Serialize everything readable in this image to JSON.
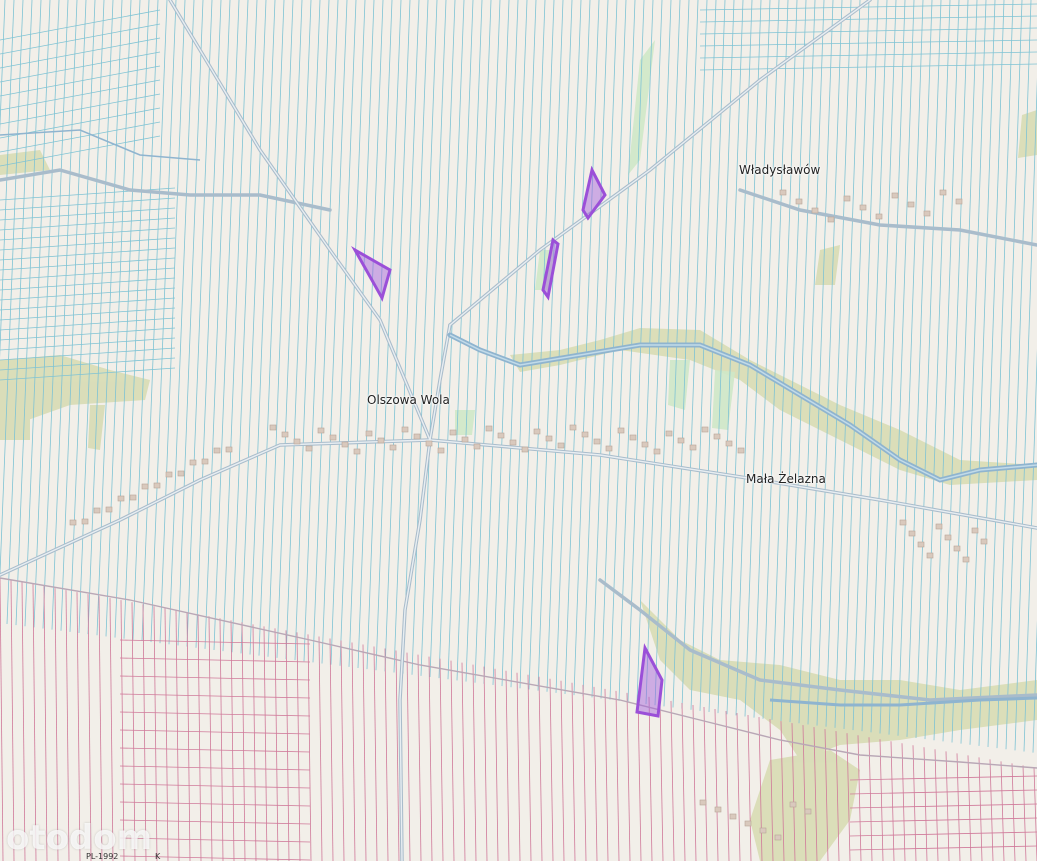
{
  "map": {
    "labels": {
      "olszowa_wola": "Olszowa Wola",
      "wladyslawow": "Władysławów",
      "mala_zelazna": "Mała Żelazna"
    },
    "watermark": "otodom",
    "scale_text_a": "PL-1992",
    "scale_text_b": "K",
    "colors": {
      "background": "#f2efe9",
      "parcel_line_blue": "#7fc3d4",
      "parcel_line_pink": "#d07a9a",
      "road": "#a9bccb",
      "river": "#8fb4cf",
      "meadow": "#d7dcb2",
      "highlight_plot": "#9b59d6"
    }
  }
}
